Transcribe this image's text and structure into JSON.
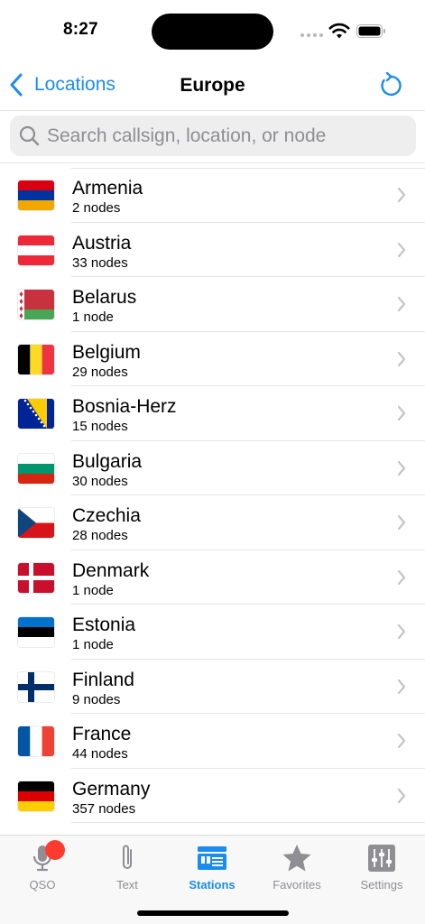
{
  "status": {
    "time": "8:27"
  },
  "nav": {
    "back_label": "Locations",
    "title": "Europe"
  },
  "search": {
    "placeholder": "Search callsign, location, or node"
  },
  "countries": [
    {
      "name": "Armenia",
      "nodes": "2 nodes",
      "flag": "armenia"
    },
    {
      "name": "Austria",
      "nodes": "33 nodes",
      "flag": "austria"
    },
    {
      "name": "Belarus",
      "nodes": "1 node",
      "flag": "belarus"
    },
    {
      "name": "Belgium",
      "nodes": "29 nodes",
      "flag": "belgium"
    },
    {
      "name": "Bosnia-Herz",
      "nodes": "15 nodes",
      "flag": "bosnia"
    },
    {
      "name": "Bulgaria",
      "nodes": "30 nodes",
      "flag": "bulgaria"
    },
    {
      "name": "Czechia",
      "nodes": "28 nodes",
      "flag": "czechia"
    },
    {
      "name": "Denmark",
      "nodes": "1 node",
      "flag": "denmark"
    },
    {
      "name": "Estonia",
      "nodes": "1 node",
      "flag": "estonia"
    },
    {
      "name": "Finland",
      "nodes": "9 nodes",
      "flag": "finland"
    },
    {
      "name": "France",
      "nodes": "44 nodes",
      "flag": "france"
    },
    {
      "name": "Germany",
      "nodes": "357 nodes",
      "flag": "germany"
    }
  ],
  "tabs": [
    {
      "label": "QSO",
      "icon": "microphone-icon"
    },
    {
      "label": "Text",
      "icon": "paperclip-icon"
    },
    {
      "label": "Stations",
      "icon": "stations-icon"
    },
    {
      "label": "Favorites",
      "icon": "star-icon"
    },
    {
      "label": "Settings",
      "icon": "sliders-icon"
    }
  ],
  "colors": {
    "accent": "#1a8cf0",
    "badge": "#ff3b30",
    "inactive": "#8e8e93"
  }
}
